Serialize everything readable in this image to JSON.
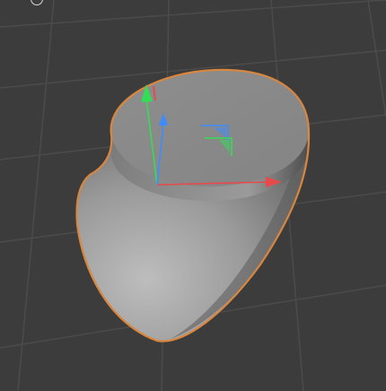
{
  "viewport": {
    "label": "",
    "background_color": "#3c3c3c",
    "grid_color": "#4a4a4a",
    "grid": true
  },
  "object": {
    "selected": true,
    "selection_outline_color": "#d9863e",
    "shape": "extruded-teardrop-solid",
    "top_face_color": "#8c8c8c",
    "side_color": "#a8a8a8"
  },
  "gizmo": {
    "type": "move-gizmo",
    "x_axis_color": "#e64a4a",
    "y_axis_color": "#33dd55",
    "z_axis_color": "#3d8cff",
    "plane_xy_color": "#3d8cff",
    "plane_xz_color": "#33dd55"
  },
  "hud": {
    "icon": "circle-icon"
  }
}
